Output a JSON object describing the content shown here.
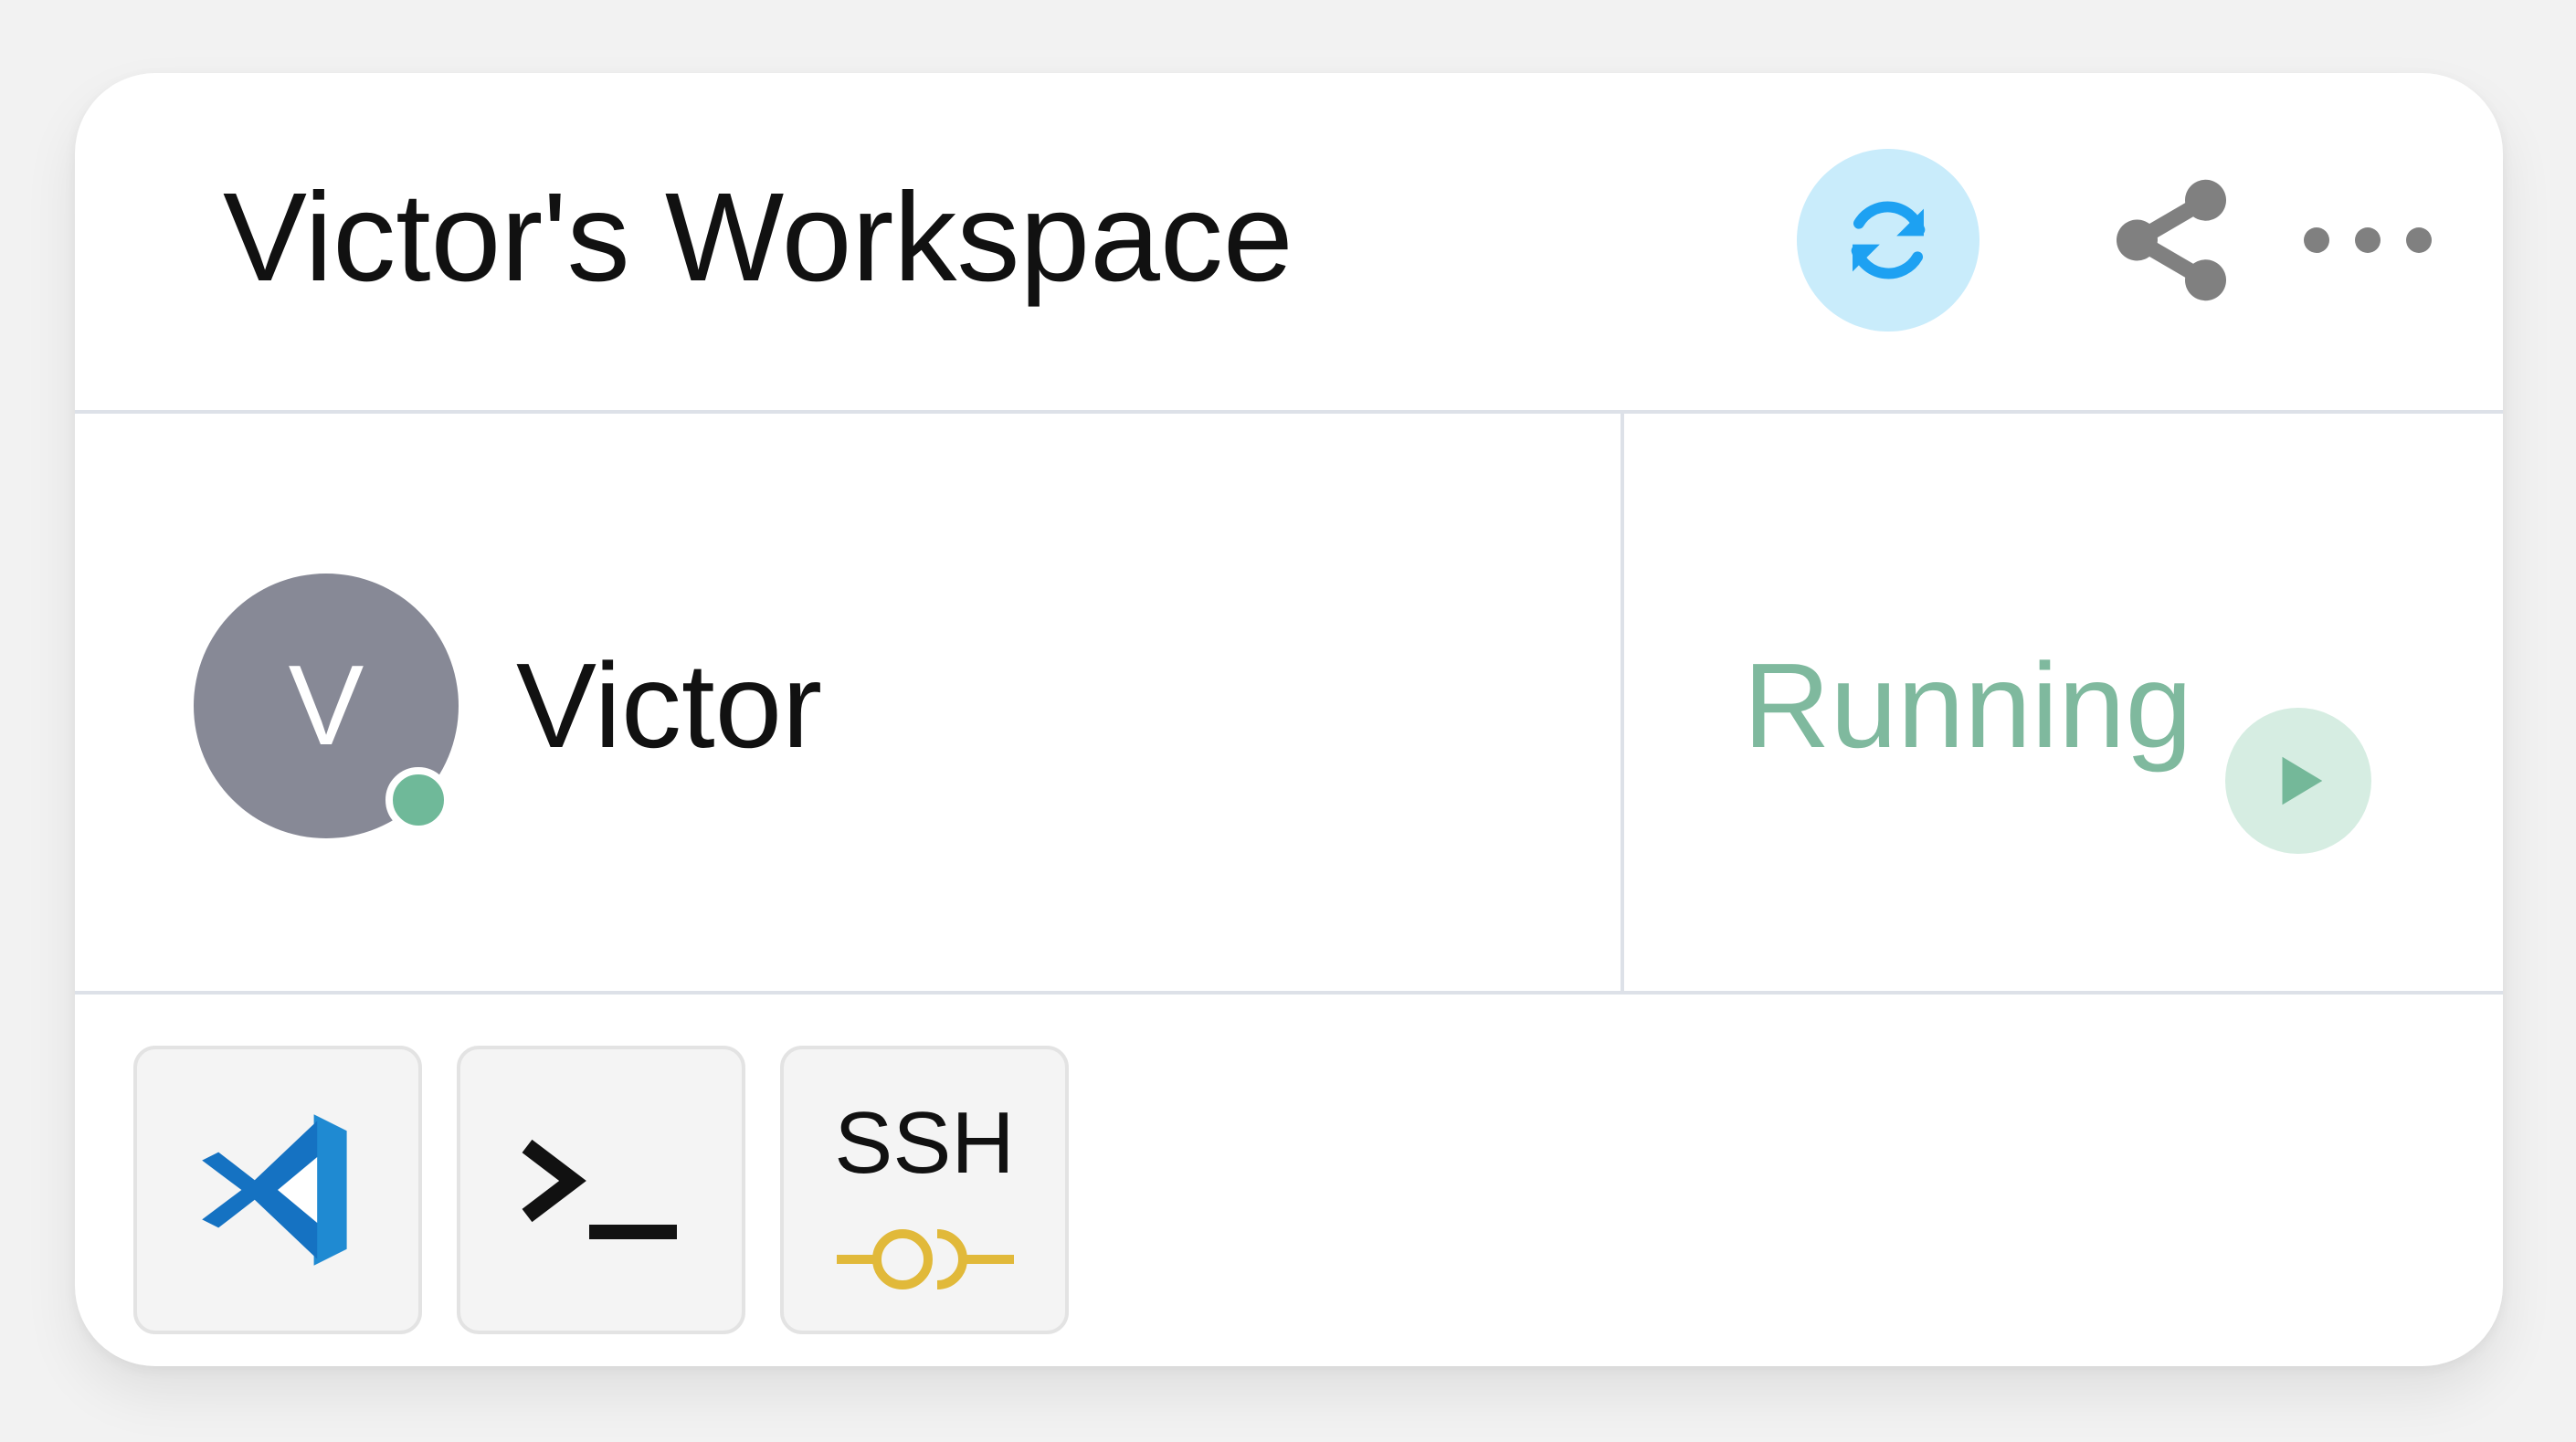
{
  "workspace": {
    "title": "Victor's Workspace"
  },
  "header": {
    "actions": [
      {
        "name": "refresh",
        "icon": "refresh-icon",
        "accent": "#1da1f2"
      },
      {
        "name": "share",
        "icon": "share-icon"
      },
      {
        "name": "more",
        "icon": "more-dots-icon"
      }
    ]
  },
  "owner": {
    "avatar_initial": "V",
    "name": "Victor",
    "online": true,
    "online_color": "#6fb999"
  },
  "status": {
    "label": "Running",
    "color": "#7fb99e",
    "action_icon": "play-icon"
  },
  "apps": [
    {
      "name": "vscode",
      "icon": "vscode-icon",
      "color": "#1f8ad2"
    },
    {
      "name": "terminal",
      "icon": "terminal-icon"
    },
    {
      "name": "ssh",
      "label": "SSH",
      "icon": "ssh-key-icon",
      "color": "#e1b93a"
    }
  ]
}
